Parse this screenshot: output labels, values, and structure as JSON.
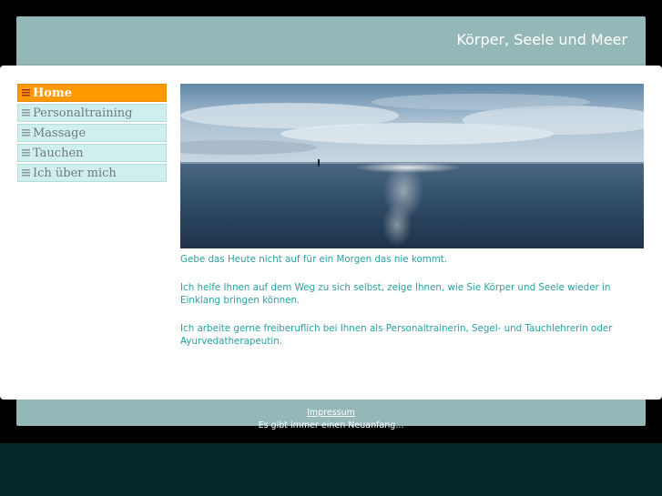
{
  "header": {
    "site_title": "Körper, Seele und Meer"
  },
  "nav": {
    "items": [
      {
        "label": "Home",
        "active": true
      },
      {
        "label": "Personaltraining",
        "active": false
      },
      {
        "label": "Massage",
        "active": false
      },
      {
        "label": "Tauchen",
        "active": false
      },
      {
        "label": "Ich über mich",
        "active": false
      }
    ]
  },
  "main": {
    "hero_image": "sea-horizon-photo",
    "paragraphs": [
      "Gebe das Heute nicht auf für ein Morgen das nie kommt.",
      "Ich helfe Ihnen auf dem Weg zu sich selbst, zeige Ihnen, wie Sie Körper und Seele wieder in Einklang bringen können.",
      "Ich arbeite gerne freiberuflich bei Ihnen als Personaltrainerin, Segel- und Tauchlehrerin oder Ayurvedatherapeutin."
    ]
  },
  "footer": {
    "impressum": "Impressum",
    "tagline": "Es gibt immer einen Neuanfang..."
  },
  "colors": {
    "accent": "#ff9900",
    "header": "#94b8b7",
    "nav_bg": "#cfeeee",
    "text": "#2aa0a0"
  }
}
